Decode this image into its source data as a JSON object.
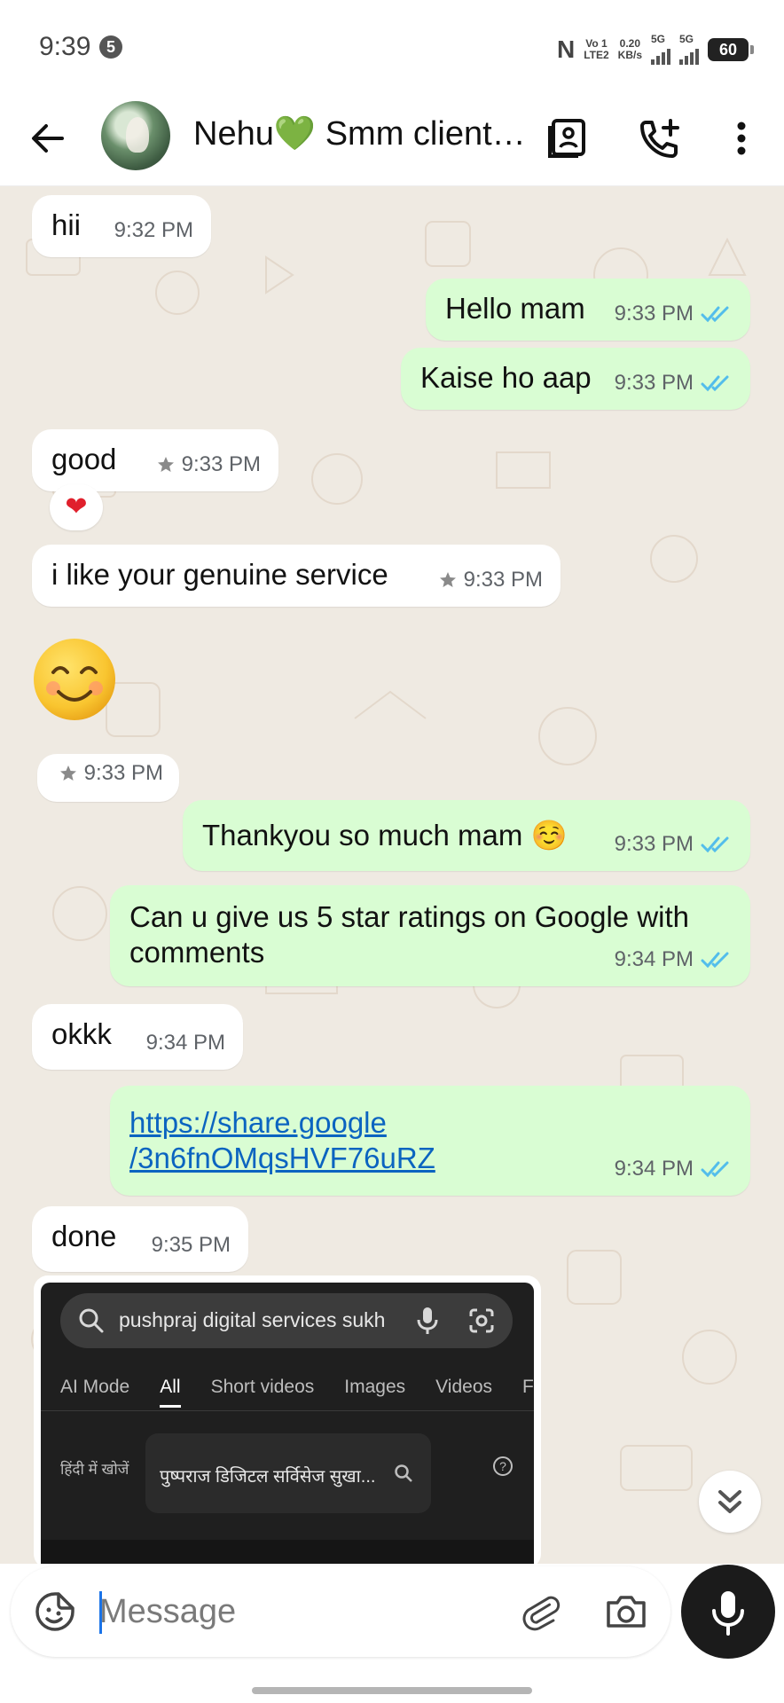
{
  "status_bar": {
    "time": "9:39",
    "notification_count": "5",
    "network_type": "N",
    "volte": "Vo 1",
    "lte": "LTE2",
    "speed": "0.20",
    "speed_unit": "KB/s",
    "sim1_label": "5G",
    "sim2_label": "5G",
    "battery": "60"
  },
  "header": {
    "contact_name": "Nehu💚 Smm client…",
    "icons": [
      "back-arrow-icon",
      "contact-card-icon",
      "add-call-icon",
      "more-vert-icon"
    ]
  },
  "messages": [
    {
      "direction": "in",
      "text": "hii",
      "time": "9:32 PM"
    },
    {
      "direction": "out",
      "text": "Hello mam",
      "time": "9:33 PM",
      "status": "read"
    },
    {
      "direction": "out",
      "text": "Kaise ho aap",
      "time": "9:33 PM",
      "status": "read"
    },
    {
      "direction": "in",
      "text": "good",
      "time": "9:33 PM",
      "starred": true,
      "reaction": "❤"
    },
    {
      "direction": "in",
      "text": "i like your genuine service",
      "time": "9:33 PM",
      "starred": true
    },
    {
      "direction": "in",
      "emoji": "😊",
      "time": "9:33 PM",
      "starred": true
    },
    {
      "direction": "out",
      "text": "Thankyou so much mam ☺️",
      "time": "9:33 PM",
      "status": "read"
    },
    {
      "direction": "out",
      "text": "Can u give us 5 star ratings on Google with comments",
      "time": "9:34 PM",
      "status": "read"
    },
    {
      "direction": "in",
      "text": "okkk",
      "time": "9:34 PM"
    },
    {
      "direction": "out",
      "link_line1": "https://share.google",
      "link_line2": "/3n6fnOMqsHVF76uRZ",
      "time": "9:34 PM",
      "status": "read"
    },
    {
      "direction": "in",
      "text": "done",
      "time": "9:35 PM"
    }
  ],
  "screenshot_preview": {
    "search_query": "pushpraj digital services sukh",
    "tabs": [
      "AI Mode",
      "All",
      "Short videos",
      "Images",
      "Videos",
      "F"
    ],
    "active_tab": "All",
    "hindi_label": "हिंदी में खोजें",
    "hindi_query": "पुष्पराज डिजिटल सर्विसेज सुखा..."
  },
  "composer": {
    "placeholder": "Message"
  },
  "colors": {
    "chat_bg": "#efeae2",
    "outgoing_bubble": "#d9fdd3",
    "incoming_bubble": "#ffffff",
    "read_tick": "#53bdeb",
    "link": "#0b64c0"
  }
}
